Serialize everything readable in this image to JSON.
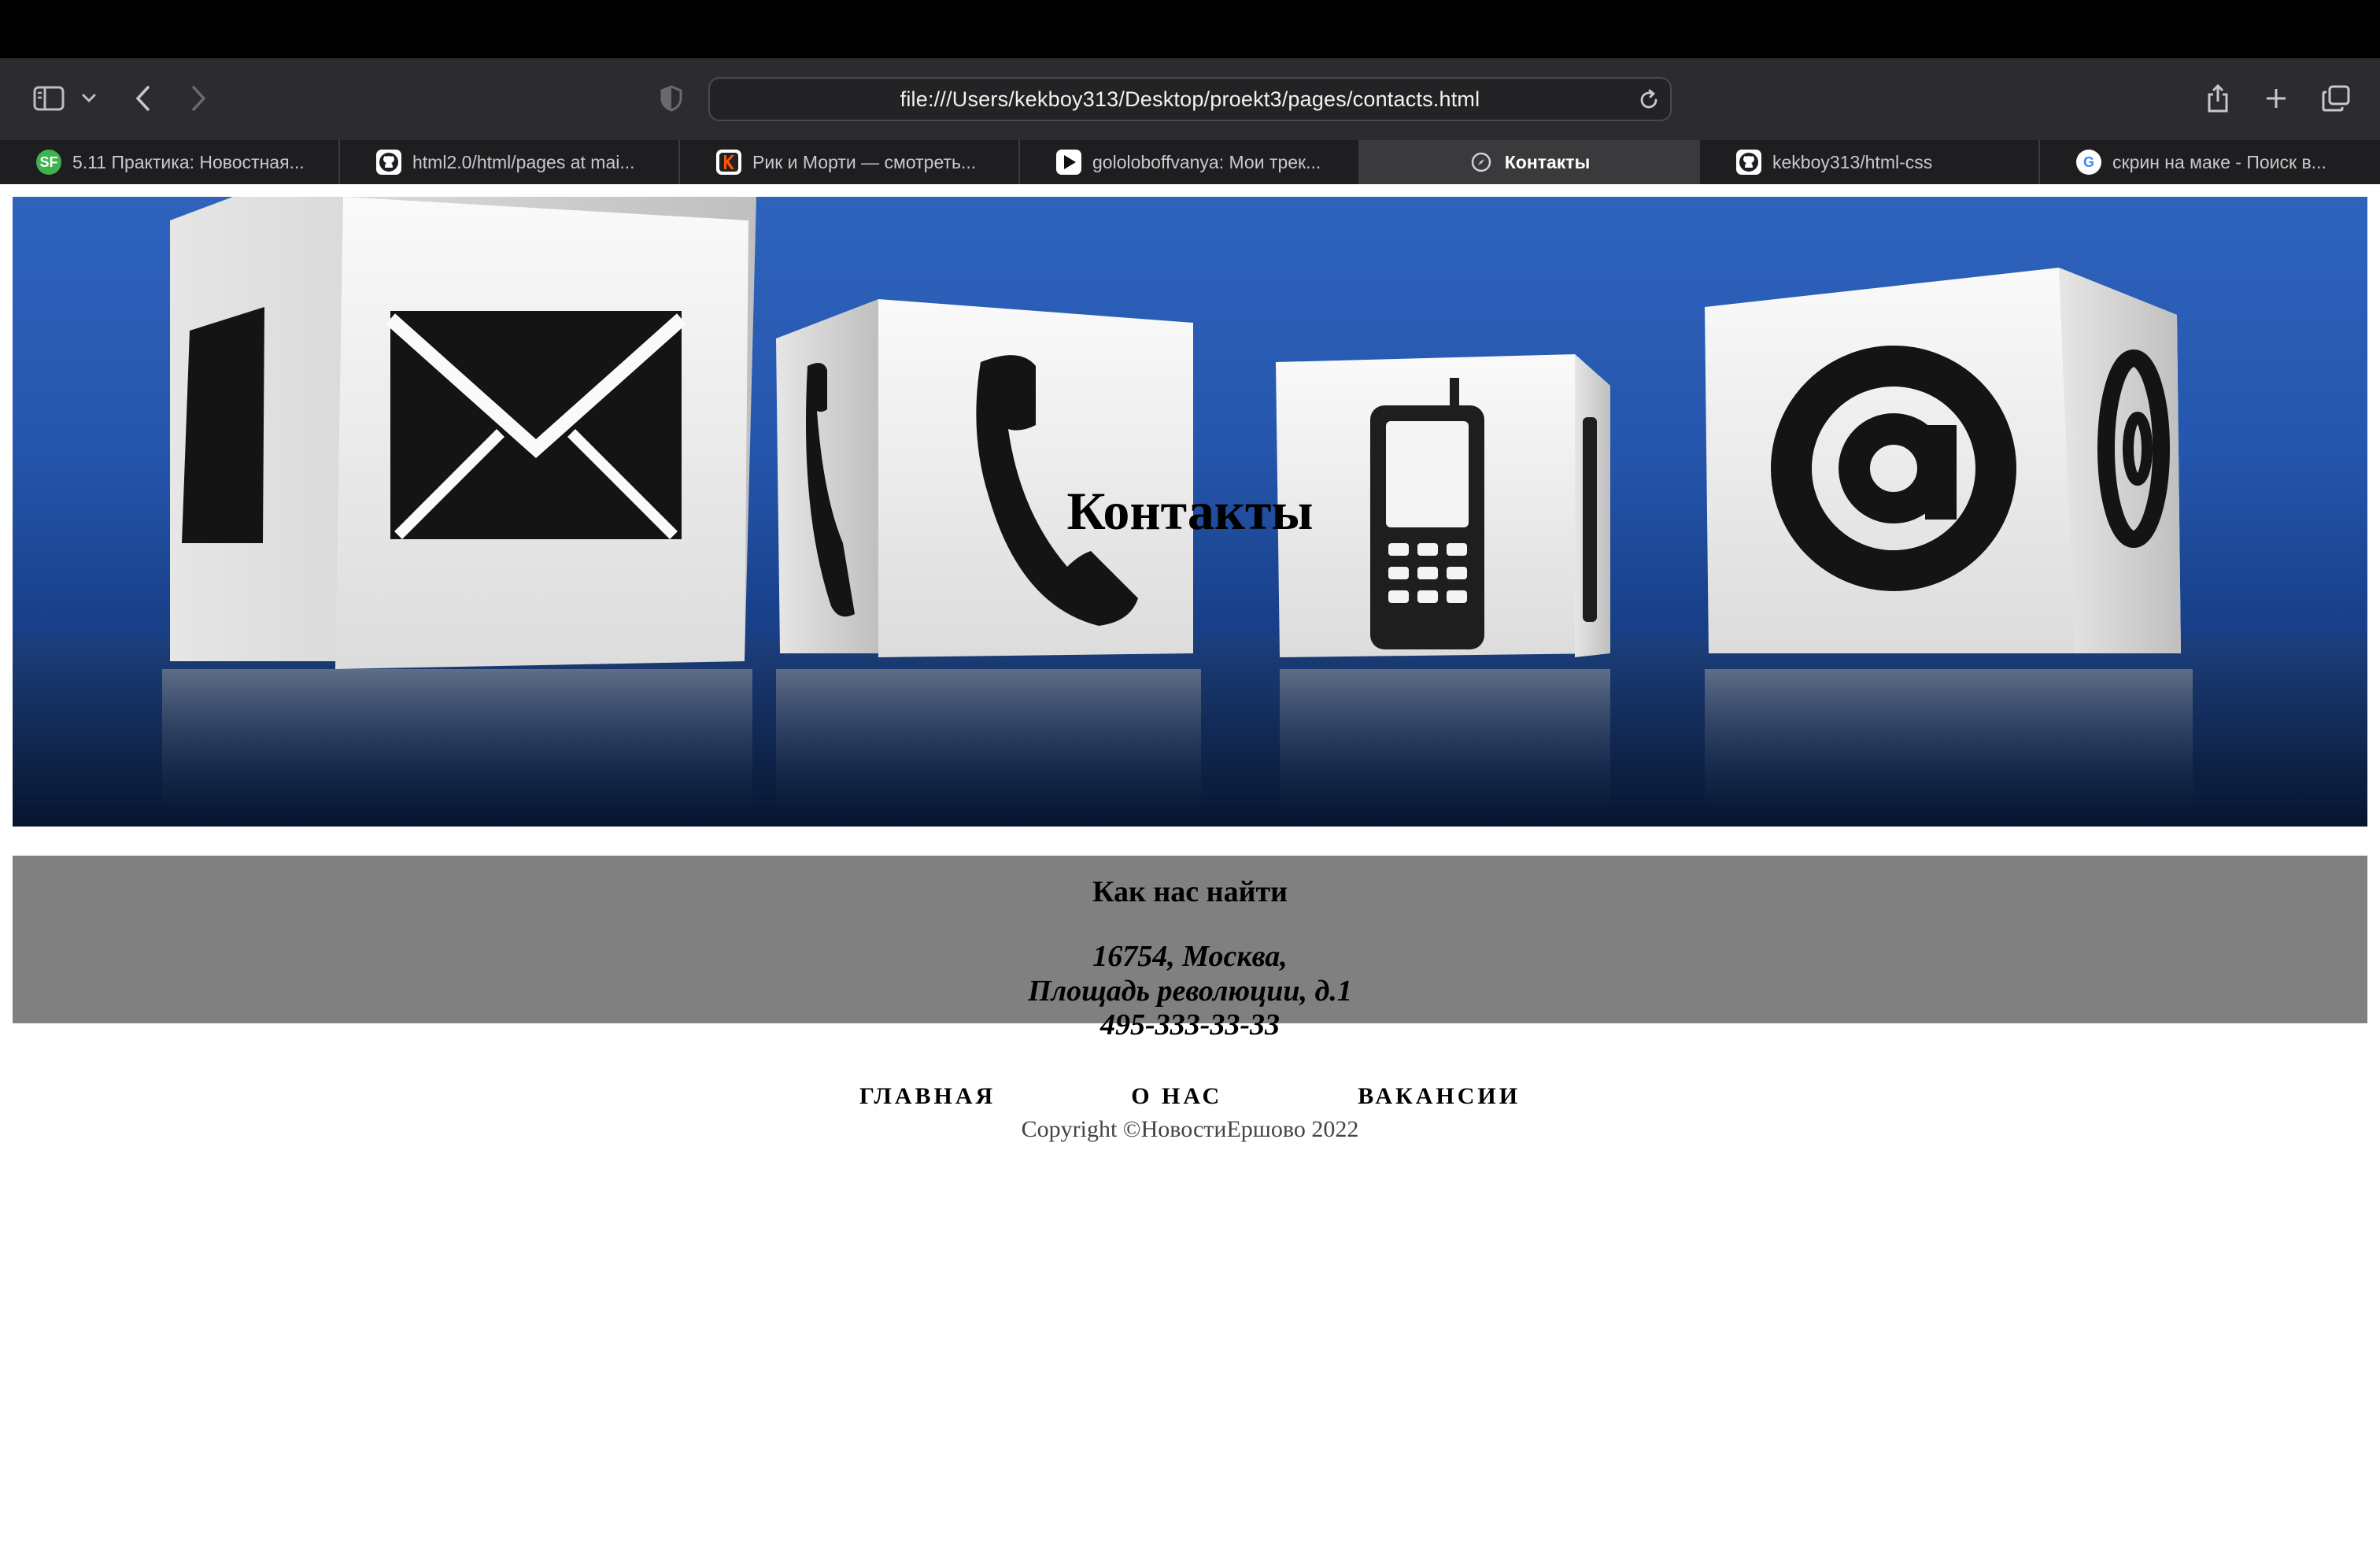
{
  "browser": {
    "url": "file:///Users/kekboy313/Desktop/proekt3/pages/contacts.html",
    "tabs": [
      {
        "label": "5.11 Практика: Новостная...",
        "icon": "sf-icon",
        "icon_color": "#3fb34f",
        "icon_text": "SF"
      },
      {
        "label": "html2.0/html/pages at mai...",
        "icon": "github-icon",
        "icon_color": "#ffffff",
        "icon_text": ""
      },
      {
        "label": "Рик и Морти — смотреть...",
        "icon": "kinopoisk-icon",
        "icon_color": "#ff5500",
        "icon_text": ""
      },
      {
        "label": "gololoboffvanya: Мои трек...",
        "icon": "play-icon",
        "icon_color": "#ffffff",
        "icon_text": ""
      },
      {
        "label": "Контакты",
        "icon": "compass-icon",
        "active": true
      },
      {
        "label": "kekboy313/html-css",
        "icon": "github-icon",
        "icon_color": "#ffffff",
        "icon_text": ""
      },
      {
        "label": "скрин на маке - Поиск в...",
        "icon": "google-icon",
        "icon_color": "#ffffff",
        "icon_text": "G"
      }
    ]
  },
  "page": {
    "hero_title": "Контакты",
    "find_title": "Как нас найти",
    "address_line1": "16754, Москва,",
    "address_line2": "Площадь революции, д.1",
    "phone": "495-333-33-33",
    "nav": [
      "ГЛАВНАЯ",
      "О НАС",
      "ВАКАНСИИ"
    ],
    "copyright": "Copyright ©НовостиЕршово 2022"
  },
  "colors": {
    "hero_blue": "#2556ad",
    "find_bg": "#808080",
    "toolbar_bg": "#2c2c2e"
  }
}
